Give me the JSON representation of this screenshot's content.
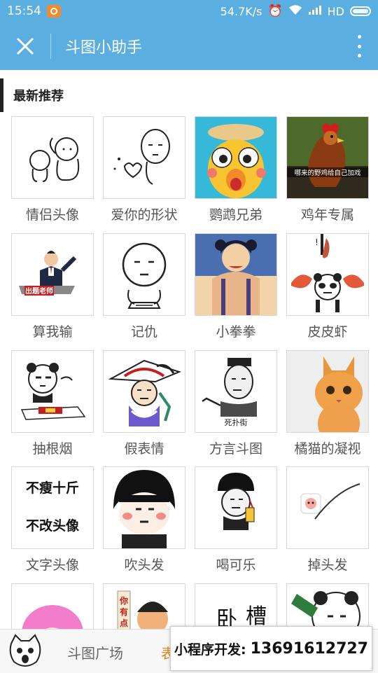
{
  "status": {
    "time": "15:54",
    "net_speed": "54.7K/s",
    "network": "HD"
  },
  "header": {
    "title": "斗图小助手"
  },
  "section": {
    "title": "最新推荐"
  },
  "grid": [
    {
      "label": "情侣头像",
      "thumb": "couple-doodle"
    },
    {
      "label": "爱你的形状",
      "thumb": "heart-doodle"
    },
    {
      "label": "鹦鹉兄弟",
      "thumb": "parrot-toy"
    },
    {
      "label": "鸡年专属",
      "thumb": "rooster",
      "overlay": "哪来的野鸡给自己加戏"
    },
    {
      "label": "算我输",
      "thumb": "speaker-podium",
      "overlay": "出题老师"
    },
    {
      "label": "记仇",
      "thumb": "note-doodle"
    },
    {
      "label": "小拳拳",
      "thumb": "anime-muscle"
    },
    {
      "label": "皮皮虾",
      "thumb": "panda-shrimp"
    },
    {
      "label": "抽根烟",
      "thumb": "panda-smoke"
    },
    {
      "label": "假表情",
      "thumb": "anime-mask"
    },
    {
      "label": "方言斗图",
      "thumb": "meme-point",
      "overlay": "死扑街"
    },
    {
      "label": "橘猫的凝视",
      "thumb": "orange-cat"
    },
    {
      "label": "文字头像",
      "thumb": "text-avatar",
      "lines": [
        "不瘦十斤",
        "不改头像"
      ]
    },
    {
      "label": "吹头发",
      "thumb": "bowl-hair"
    },
    {
      "label": "喝可乐",
      "thumb": "cola-meme"
    },
    {
      "label": "掉头发",
      "thumb": "hair-loss"
    },
    {
      "label": "",
      "thumb": "pink-hair"
    },
    {
      "label": "",
      "thumb": "you-have",
      "overlay": "你有点"
    },
    {
      "label": "",
      "thumb": "calligraphy"
    },
    {
      "label": "",
      "thumb": "panda-bottle"
    }
  ],
  "bottom": {
    "tab_square": "斗图广场",
    "tab_partial": "表",
    "promo_label": "小程序开发:",
    "promo_phone": "13691612727"
  },
  "colors": {
    "header": "#5aaee0",
    "accent": "#e08a1e"
  }
}
